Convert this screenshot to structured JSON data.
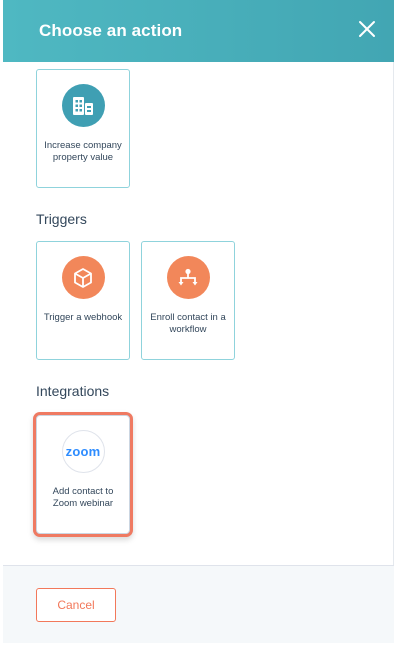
{
  "dialog": {
    "title": "Choose an action",
    "close_icon": "close-icon"
  },
  "cards_top": [
    {
      "label": "Increase company property value",
      "icon": "building-icon",
      "color": "#3f9fb3"
    }
  ],
  "triggers": {
    "title": "Triggers",
    "items": [
      {
        "label": "Trigger a webhook",
        "icon": "cube-icon",
        "color": "#f2875a"
      },
      {
        "label": "Enroll contact in a workflow",
        "icon": "workflow-icon",
        "color": "#f2875a"
      }
    ]
  },
  "integrations": {
    "title": "Integrations",
    "items": [
      {
        "label": "Add contact to Zoom webinar",
        "icon": "zoom-logo",
        "logo_text": "zoom",
        "color": "#2d8cff",
        "highlight_color": "#ef7a62"
      }
    ]
  },
  "footer": {
    "cancel_label": "Cancel"
  }
}
